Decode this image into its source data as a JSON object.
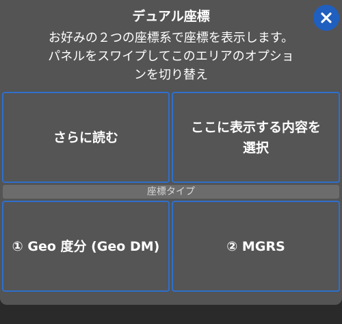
{
  "dialog": {
    "title": "デュアル座標",
    "close_icon": "close-icon",
    "description_lines": [
      "お好みの２つの座標系で座標を表示します。",
      "パネルをスワイプしてこのエリアのオプショ",
      "ンを切り替え"
    ]
  },
  "top_options": {
    "read_more": "さらに読む",
    "choose_lines": [
      "ここに表示する内容を",
      "選択"
    ]
  },
  "coordinate_type": {
    "label": "座標タイプ",
    "options": [
      "① Geo 度分 (Geo DM)",
      "② MGRS"
    ]
  },
  "colors": {
    "accent": "#2e6fcc",
    "close_button": "#1f5fbf",
    "panel": "#565656"
  }
}
